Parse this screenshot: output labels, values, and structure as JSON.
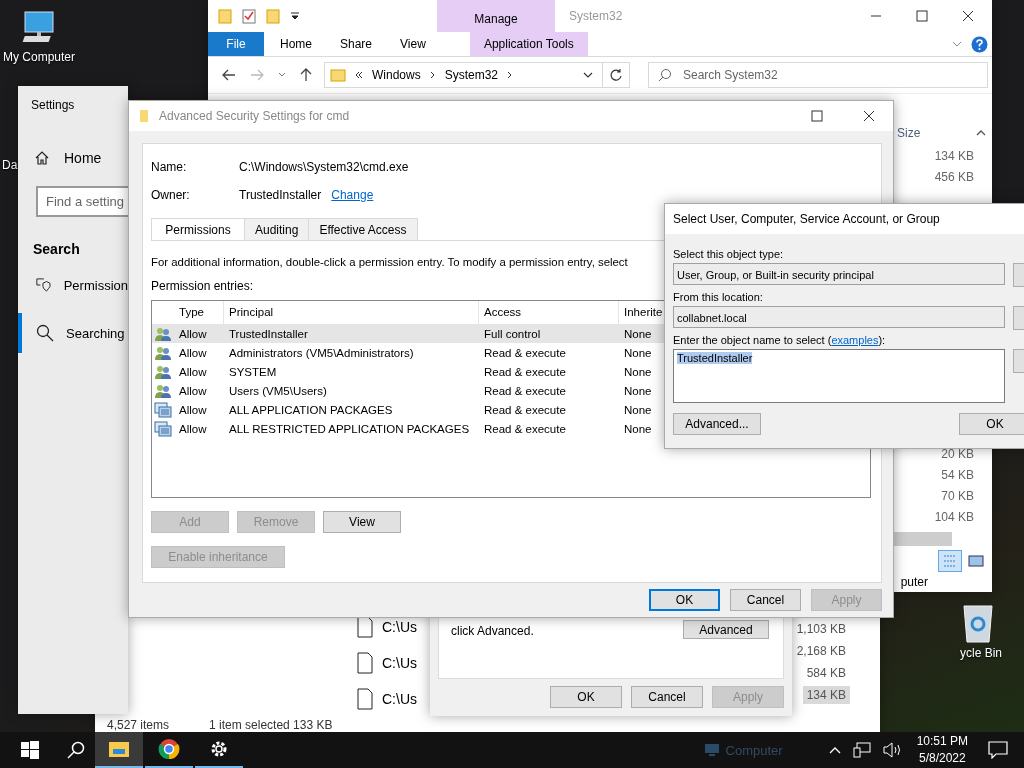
{
  "desktop": {
    "icons": [
      {
        "label": "My Computer",
        "kind": "computer"
      },
      {
        "label": "Da",
        "kind": "partial"
      },
      {
        "label": "ycle Bin",
        "kind": "recycle"
      }
    ]
  },
  "explorer": {
    "title": "System32",
    "contextual_group": "Manage",
    "ribbon_tabs": [
      {
        "label": "File",
        "kind": "file"
      },
      {
        "label": "Home",
        "kind": "tab"
      },
      {
        "label": "Share",
        "kind": "tab"
      },
      {
        "label": "View",
        "kind": "tab"
      },
      {
        "label": "Application Tools",
        "kind": "contextual"
      }
    ],
    "address": {
      "crumbs": [
        "Windows",
        "System32"
      ]
    },
    "search": {
      "placeholder": "Search System32"
    },
    "size_column": {
      "header": "Size",
      "sizes": [
        "134 KB",
        "456 KB"
      ],
      "lower_sizes": [
        "20 KB",
        "54 KB",
        "70 KB",
        "104 KB"
      ]
    },
    "status_bar": "puter"
  },
  "settings": {
    "title": "Settings",
    "home": "Home",
    "search": {
      "placeholder": "Find a setting"
    },
    "section": "Search",
    "items": [
      {
        "label": "Permission",
        "kind": "permission",
        "selected": false
      },
      {
        "label": "Searching",
        "kind": "search",
        "selected": true
      }
    ]
  },
  "security": {
    "title": "Advanced Security Settings for cmd",
    "name_label": "Name:",
    "name": "C:\\Windows\\System32\\cmd.exe",
    "owner_label": "Owner:",
    "owner": "TrustedInstaller",
    "change_link": "Change",
    "tabs": [
      {
        "label": "Permissions",
        "selected": true
      },
      {
        "label": "Auditing",
        "selected": false
      },
      {
        "label": "Effective Access",
        "selected": false
      }
    ],
    "info": "For additional information, double-click a permission entry. To modify a permission entry, select",
    "entries_label": "Permission entries:",
    "columns": [
      "Type",
      "Principal",
      "Access",
      "Inherite"
    ],
    "rows": [
      {
        "kind": "group",
        "type": "Allow",
        "principal": "TrustedInstaller",
        "access": "Full control",
        "inherited": "None",
        "selected": true
      },
      {
        "kind": "group",
        "type": "Allow",
        "principal": "Administrators (VM5\\Administrators)",
        "access": "Read & execute",
        "inherited": "None",
        "selected": false
      },
      {
        "kind": "group",
        "type": "Allow",
        "principal": "SYSTEM",
        "access": "Read & execute",
        "inherited": "None",
        "selected": false
      },
      {
        "kind": "group",
        "type": "Allow",
        "principal": "Users (VM5\\Users)",
        "access": "Read & execute",
        "inherited": "None",
        "selected": false
      },
      {
        "kind": "package",
        "type": "Allow",
        "principal": "ALL APPLICATION PACKAGES",
        "access": "Read & execute",
        "inherited": "None",
        "selected": false
      },
      {
        "kind": "package",
        "type": "Allow",
        "principal": "ALL RESTRICTED APPLICATION PACKAGES",
        "access": "Read & execute",
        "inherited": "None",
        "selected": false
      }
    ],
    "entry_buttons": [
      {
        "label": "Add",
        "disabled": true
      },
      {
        "label": "Remove",
        "disabled": true
      },
      {
        "label": "View",
        "disabled": false
      }
    ],
    "inheritance_button": {
      "label": "Enable inheritance",
      "disabled": true
    },
    "footer": [
      {
        "label": "OK",
        "default": true,
        "disabled": false
      },
      {
        "label": "Cancel",
        "default": false,
        "disabled": false
      },
      {
        "label": "Apply",
        "default": false,
        "disabled": true
      }
    ]
  },
  "select_dialog": {
    "title": "Select User, Computer, Service Account, or Group",
    "object_type_label": "Select this object type:",
    "object_type": "User, Group, or Built-in security principal",
    "location_label": "From this location:",
    "location": "collabnet.local",
    "name_label_before": "Enter the object name to select (",
    "examples_link": "examples",
    "name_label_after": "):",
    "name_value": "TrustedInstaller",
    "name_value_highlighted": true,
    "advanced_button": "Advanced...",
    "ok_button": "OK"
  },
  "lower_properties": {
    "text": "click Advanced.",
    "advanced_button": "Advanced",
    "footer": [
      {
        "label": "OK",
        "disabled": false
      },
      {
        "label": "Cancel",
        "disabled": false
      },
      {
        "label": "Apply",
        "disabled": true
      }
    ]
  },
  "lower_explorer": {
    "rows": [
      "C:\\Us",
      "C:\\Us",
      "C:\\Us"
    ],
    "sizes": [
      {
        "text": "1,103 KB",
        "selected": false
      },
      {
        "text": "2,168 KB",
        "selected": false
      },
      {
        "text": "584 KB",
        "selected": false
      },
      {
        "text": "134 KB",
        "selected": true
      }
    ],
    "status": {
      "count": "4,527 items",
      "selection": "1 item selected  133 KB"
    }
  },
  "taskbar": {
    "apps": [
      {
        "kind": "explorer",
        "active": true
      },
      {
        "kind": "chrome",
        "active": false
      },
      {
        "kind": "settings",
        "active": false
      }
    ],
    "ghost_label": "Computer",
    "time": "10:51 PM",
    "date": "5/8/2022"
  }
}
